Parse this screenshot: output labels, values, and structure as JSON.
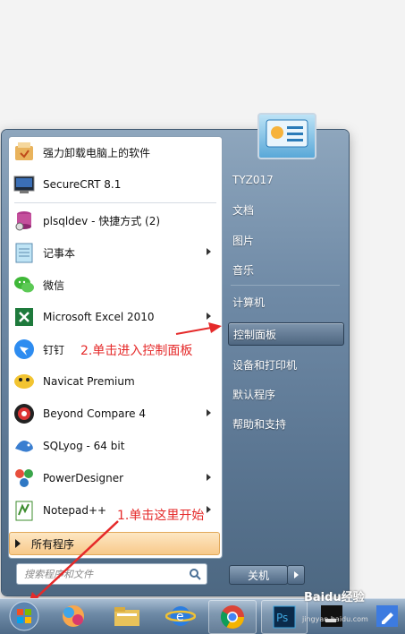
{
  "programs": [
    {
      "label": "强力卸载电脑上的软件",
      "icon": "uninstaller-icon",
      "has_submenu": false
    },
    {
      "label": "SecureCRT 8.1",
      "icon": "securecrt-icon",
      "has_submenu": false
    },
    {
      "label": "plsqldev - 快捷方式 (2)",
      "icon": "plsqldev-icon",
      "has_submenu": false
    },
    {
      "label": "记事本",
      "icon": "notepad-icon",
      "has_submenu": true
    },
    {
      "label": "微信",
      "icon": "wechat-icon",
      "has_submenu": false
    },
    {
      "label": "Microsoft Excel 2010",
      "icon": "excel-icon",
      "has_submenu": true
    },
    {
      "label": "钉钉",
      "icon": "dingtalk-icon",
      "has_submenu": false
    },
    {
      "label": "Navicat Premium",
      "icon": "navicat-icon",
      "has_submenu": false
    },
    {
      "label": "Beyond Compare 4",
      "icon": "beyond-compare-icon",
      "has_submenu": true
    },
    {
      "label": "SQLyog - 64 bit",
      "icon": "sqlyog-icon",
      "has_submenu": false
    },
    {
      "label": "PowerDesigner",
      "icon": "powerdesigner-icon",
      "has_submenu": true
    },
    {
      "label": "Notepad++",
      "icon": "notepad-plus-plus-icon",
      "has_submenu": true
    }
  ],
  "all_programs_label": "所有程序",
  "search": {
    "placeholder": "搜索程序和文件"
  },
  "right_pane": {
    "user": "TYZ017",
    "documents": "文档",
    "pictures": "图片",
    "music": "音乐",
    "computer": "计算机",
    "control_panel": "控制面板",
    "devices": "设备和打印机",
    "default_programs": "默认程序",
    "help": "帮助和支持"
  },
  "shutdown_label": "关机",
  "annotations": {
    "step1": "1.单击这里开始",
    "step2": "2.单击进入控制面板"
  },
  "watermark": {
    "main": "Baidu经验",
    "sub": "jingyan.baidu.com"
  },
  "colors": {
    "annotation": "#e52a2a",
    "highlight": "#f8c98a"
  }
}
